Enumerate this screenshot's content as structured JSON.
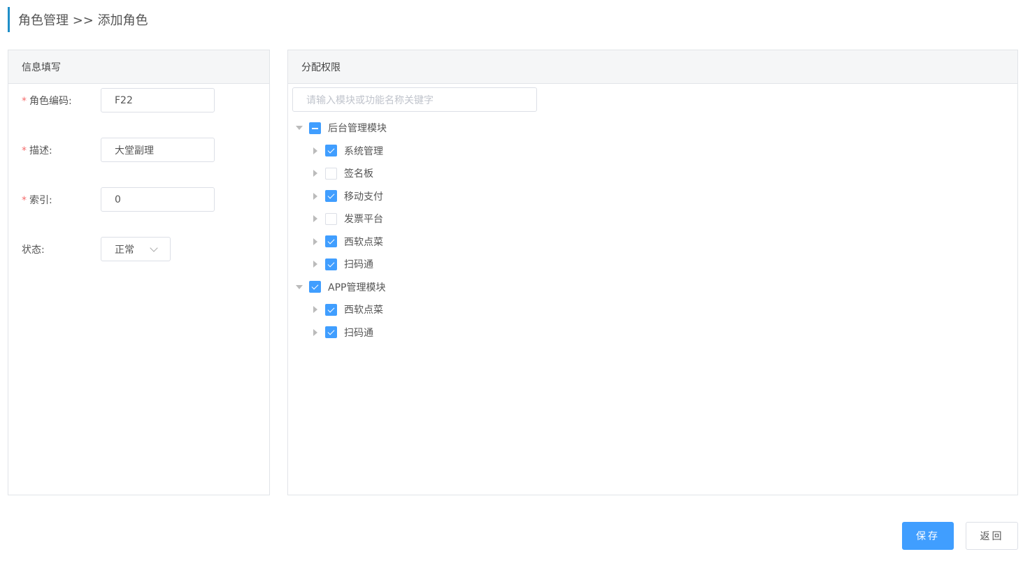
{
  "header": {
    "breadcrumb": "角色管理 >> 添加角色"
  },
  "left_panel": {
    "title": "信息填写",
    "fields": [
      {
        "label": "角色编码:",
        "required": true,
        "value": "F22"
      },
      {
        "label": "描述:",
        "required": true,
        "value": "大堂副理"
      },
      {
        "label": "索引:",
        "required": true,
        "value": "0"
      }
    ],
    "status": {
      "label": "状态:",
      "value": "正常"
    }
  },
  "right_panel": {
    "title": "分配权限",
    "search_placeholder": "请输入模块或功能名称关键字",
    "tree": [
      {
        "label": "后台管理模块",
        "level": 0,
        "expanded": true,
        "state": "indeterminate"
      },
      {
        "label": "系统管理",
        "level": 1,
        "expanded": false,
        "state": "checked"
      },
      {
        "label": "签名板",
        "level": 1,
        "expanded": false,
        "state": "unchecked"
      },
      {
        "label": "移动支付",
        "level": 1,
        "expanded": false,
        "state": "checked"
      },
      {
        "label": "发票平台",
        "level": 1,
        "expanded": false,
        "state": "unchecked"
      },
      {
        "label": "西软点菜",
        "level": 1,
        "expanded": false,
        "state": "checked"
      },
      {
        "label": "扫码通",
        "level": 1,
        "expanded": false,
        "state": "checked"
      },
      {
        "label": "APP管理模块",
        "level": 0,
        "expanded": true,
        "state": "checked"
      },
      {
        "label": "西软点菜",
        "level": 1,
        "expanded": false,
        "state": "checked"
      },
      {
        "label": "扫码通",
        "level": 1,
        "expanded": false,
        "state": "checked"
      }
    ]
  },
  "actions": {
    "save_label": "保存",
    "back_label": "返回"
  },
  "colors": {
    "accent": "#409eff",
    "header_bar": "#1f8ec8",
    "required": "#f56c6c"
  }
}
